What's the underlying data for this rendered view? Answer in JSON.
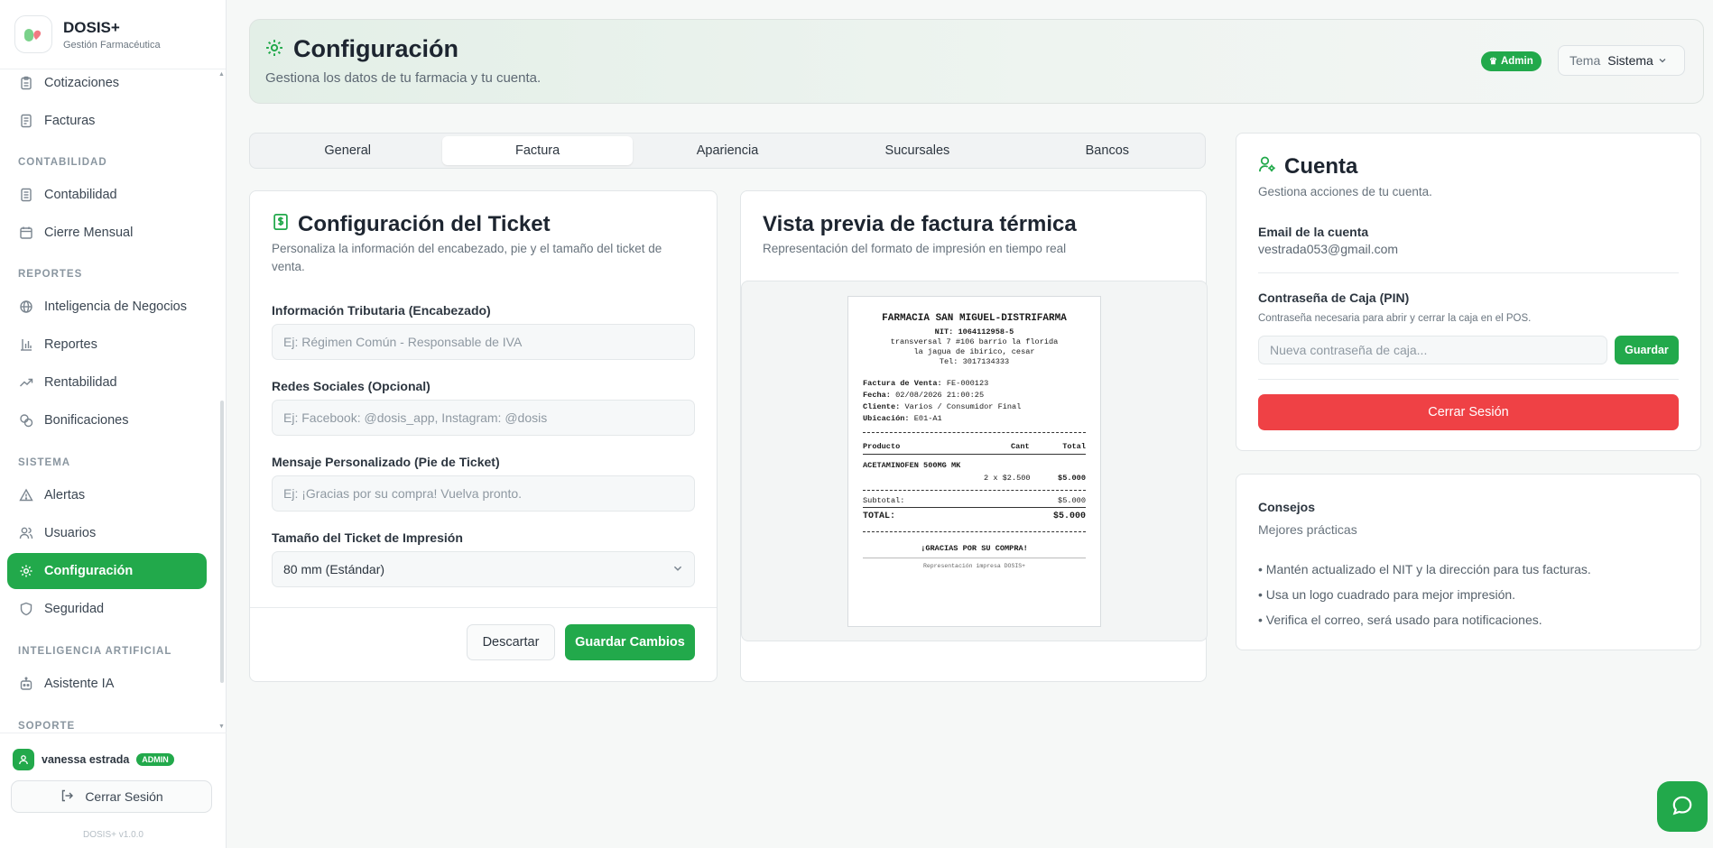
{
  "app": {
    "name": "DOSIS+",
    "subtitle": "Gestión Farmacéutica",
    "version": "DOSIS+ v1.0.0"
  },
  "sidebar": {
    "items": [
      {
        "label": "Cotizaciones",
        "icon": "clipboard-icon"
      },
      {
        "label": "Facturas",
        "icon": "receipt-icon"
      },
      {
        "section": "CONTABILIDAD"
      },
      {
        "label": "Contabilidad",
        "icon": "ledger-icon"
      },
      {
        "label": "Cierre Mensual",
        "icon": "calendar-icon"
      },
      {
        "section": "REPORTES"
      },
      {
        "label": "Inteligencia de Negocios",
        "icon": "globe-icon"
      },
      {
        "label": "Reportes",
        "icon": "bar-chart-icon"
      },
      {
        "label": "Rentabilidad",
        "icon": "trending-up-icon"
      },
      {
        "label": "Bonificaciones",
        "icon": "coins-icon"
      },
      {
        "section": "SISTEMA"
      },
      {
        "label": "Alertas",
        "icon": "warning-icon"
      },
      {
        "label": "Usuarios",
        "icon": "users-icon"
      },
      {
        "label": "Configuración",
        "icon": "gear-icon",
        "active": true
      },
      {
        "label": "Seguridad",
        "icon": "shield-icon"
      },
      {
        "section": "INTELIGENCIA ARTIFICIAL"
      },
      {
        "label": "Asistente IA",
        "icon": "robot-icon"
      },
      {
        "section": "SOPORTE"
      }
    ],
    "user": {
      "name": "vanessa estrada",
      "role": "ADMIN"
    },
    "logout_label": "Cerrar Sesión"
  },
  "header": {
    "title": "Configuración",
    "subtitle": "Gestiona los datos de tu farmacia y tu cuenta.",
    "admin_badge": "Admin",
    "theme_label": "Tema",
    "theme_value": "Sistema"
  },
  "tabs": [
    {
      "label": "General"
    },
    {
      "label": "Factura",
      "active": true
    },
    {
      "label": "Apariencia"
    },
    {
      "label": "Sucursales"
    },
    {
      "label": "Bancos"
    }
  ],
  "ticket_config": {
    "title": "Configuración del Ticket",
    "description": "Personaliza la información del encabezado, pie y el tamaño del ticket de venta.",
    "fields": {
      "tax_label": "Información Tributaria (Encabezado)",
      "tax_placeholder": "Ej: Régimen Común - Responsable de IVA",
      "social_label": "Redes Sociales (Opcional)",
      "social_placeholder": "Ej: Facebook: @dosis_app, Instagram: @dosis",
      "message_label": "Mensaje Personalizado (Pie de Ticket)",
      "message_placeholder": "Ej: ¡Gracias por su compra! Vuelva pronto.",
      "size_label": "Tamaño del Ticket de Impresión",
      "size_value": "80 mm (Estándar)"
    },
    "discard_label": "Descartar",
    "save_label": "Guardar Cambios"
  },
  "preview": {
    "title": "Vista previa de factura térmica",
    "subtitle": "Representación del formato de impresión en tiempo real",
    "ticket": {
      "store": "FARMACIA SAN MIGUEL-DISTRIFARMA",
      "nit": "NIT: 1064112958-5",
      "address1": "transversal 7 #106 barrio la florida",
      "address2": "la jagua de ibirico, cesar",
      "phone": "Tel: 3017134333",
      "sale_label": "Factura de Venta:",
      "sale_value": "FE-000123",
      "date_label": "Fecha:",
      "date_value": "02/08/2026 21:00:25",
      "client_label": "Cliente:",
      "client_value": "Varios / Consumidor Final",
      "location_label": "Ubicación:",
      "location_value": "E01-A1",
      "col_product": "Producto",
      "col_qty": "Cant",
      "col_total": "Total",
      "item_name": "ACETAMINOFEN 500MG MK",
      "item_qty": "2 x $2.500",
      "item_total": "$5.000",
      "subtotal_label": "Subtotal:",
      "subtotal_value": "$5.000",
      "total_label": "TOTAL:",
      "total_value": "$5.000",
      "thanks": "¡GRACIAS POR SU COMPRA!",
      "footer": "Representación impresa DOSIS+"
    }
  },
  "account": {
    "title": "Cuenta",
    "subtitle": "Gestiona acciones de tu cuenta.",
    "email_label": "Email de la cuenta",
    "email_value": "vestrada053@gmail.com",
    "pin_label": "Contraseña de Caja (PIN)",
    "pin_help": "Contraseña necesaria para abrir y cerrar la caja en el POS.",
    "pin_placeholder": "Nueva contraseña de caja...",
    "pin_save": "Guardar",
    "logout_label": "Cerrar Sesión"
  },
  "tips": {
    "title": "Consejos",
    "subtitle": "Mejores prácticas",
    "items": [
      "• Mantén actualizado el NIT y la dirección para tus facturas.",
      "• Usa un logo cuadrado para mejor impresión.",
      "• Verifica el correo, será usado para notificaciones."
    ]
  },
  "colors": {
    "accent": "#22a94b",
    "danger": "#ef4145",
    "header_bg": "#e3efe7"
  }
}
